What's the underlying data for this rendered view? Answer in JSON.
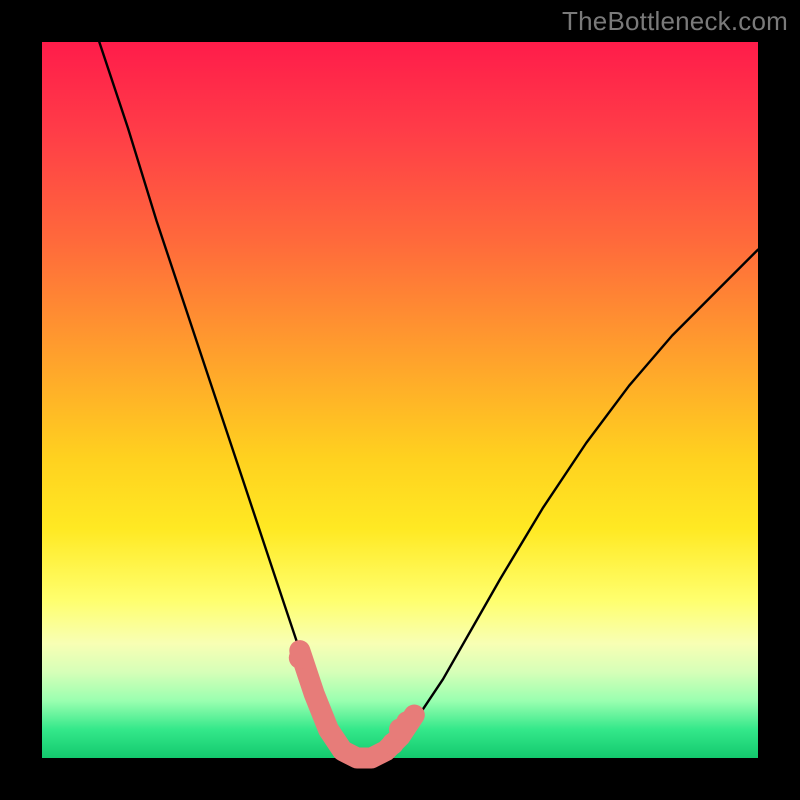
{
  "watermark": "TheBottleneck.com",
  "colors": {
    "background": "#000000",
    "gradient_top": "#ff1c4a",
    "gradient_bottom": "#13c96e",
    "curve": "#000000",
    "marker": "#e77c79",
    "watermark_text": "#7a7a7a"
  },
  "chart_data": {
    "type": "line",
    "title": "",
    "xlabel": "",
    "ylabel": "",
    "xlim": [
      0,
      100
    ],
    "ylim": [
      0,
      100
    ],
    "grid": false,
    "legend": false,
    "annotations": [
      "TheBottleneck.com"
    ],
    "series": [
      {
        "name": "bottleneck-curve",
        "x": [
          8,
          12,
          16,
          20,
          24,
          28,
          32,
          34,
          36,
          38,
          40,
          42,
          44,
          46,
          48,
          52,
          56,
          60,
          64,
          70,
          76,
          82,
          88,
          94,
          100
        ],
        "y": [
          100,
          88,
          75,
          63,
          51,
          39,
          27,
          21,
          15,
          9,
          4,
          1,
          0,
          0,
          1,
          5,
          11,
          18,
          25,
          35,
          44,
          52,
          59,
          65,
          71
        ]
      }
    ],
    "highlight_region": {
      "name": "optimal-zone",
      "x": [
        36,
        38,
        40,
        42,
        44,
        46,
        48,
        50,
        52
      ],
      "y": [
        15,
        9,
        4,
        1,
        0,
        0,
        1,
        3,
        6
      ]
    },
    "highlight_dots": [
      {
        "x": 36,
        "y": 14
      },
      {
        "x": 49,
        "y": 2
      },
      {
        "x": 50,
        "y": 4
      },
      {
        "x": 51,
        "y": 5
      }
    ]
  }
}
